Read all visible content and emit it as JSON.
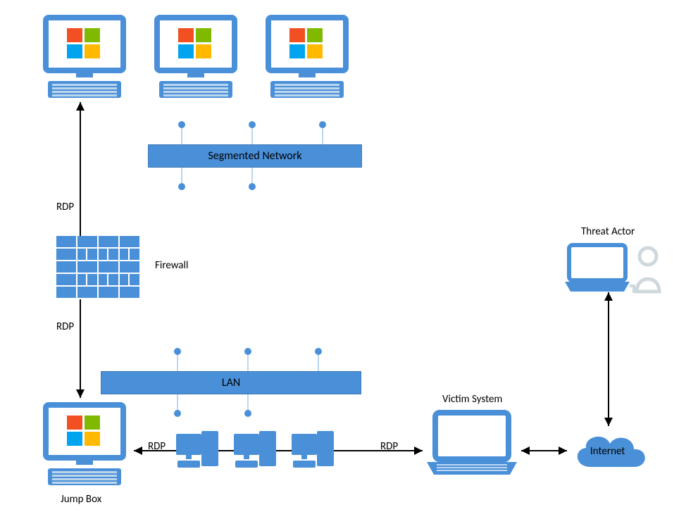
{
  "labels": {
    "segmented_network": "Segmented Network",
    "lan": "LAN",
    "firewall": "Firewall",
    "jump_box": "Jump Box",
    "victim_system": "Victim System",
    "threat_actor": "Threat Actor",
    "internet": "Internet",
    "rdp": "RDP"
  },
  "colors": {
    "primary": "#4a90d9",
    "win_red": "#f25022",
    "win_green": "#7fba00",
    "win_blue": "#00a4ef",
    "win_yellow": "#ffb900"
  }
}
